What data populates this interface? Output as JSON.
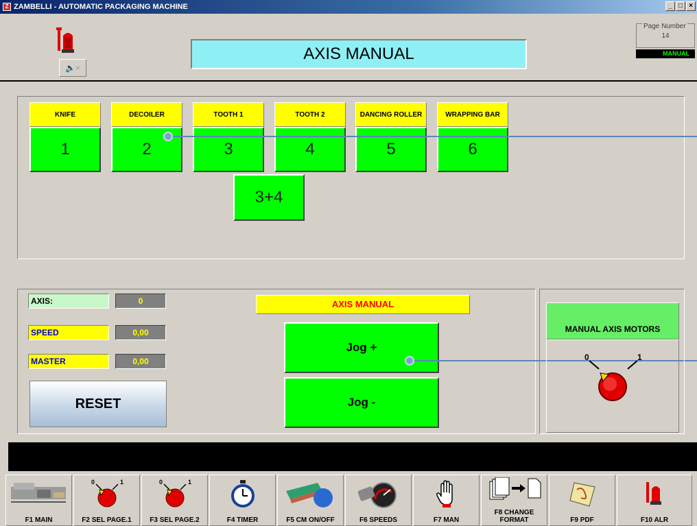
{
  "window": {
    "title": "ZAMBELLI - AUTOMATIC PACKAGING MACHINE",
    "controls": [
      "_",
      "□",
      "×"
    ]
  },
  "header": {
    "title": "AXIS MANUAL",
    "page_number_label": "Page Number",
    "page_number": "14",
    "mode": "MANUAL",
    "mute_icon": "speaker-mute-icon"
  },
  "axes": [
    {
      "label": "KNIFE",
      "number": "1"
    },
    {
      "label": "DECOILER",
      "number": "2"
    },
    {
      "label": "TOOTH 1",
      "number": "3"
    },
    {
      "label": "TOOTH 2",
      "number": "4"
    },
    {
      "label": "DANCING ROLLER",
      "number": "5"
    },
    {
      "label": "WRAPPING BAR",
      "number": "6"
    }
  ],
  "combo_axis": "3+4",
  "fields": {
    "axis": {
      "label": "AXIS:",
      "value": "0"
    },
    "speed": {
      "label": "SPEED",
      "value": "0,00"
    },
    "master": {
      "label": "MASTER",
      "value": "0,00"
    }
  },
  "reset_label": "RESET",
  "axis_manual_label": "AXIS MANUAL",
  "jog_plus": "Jog +",
  "jog_minus": "Jog -",
  "motors": {
    "title": "MANUAL AXIS MOTORS",
    "pos0": "0",
    "pos1": "1"
  },
  "fkeys": [
    {
      "label": "F1 MAIN",
      "icon": "machine-icon"
    },
    {
      "label": "F2 SEL PAGE.1",
      "icon": "selector-icon",
      "p0": "0",
      "p1": "1"
    },
    {
      "label": "F3 SEL PAGE.2",
      "icon": "selector-icon",
      "p0": "0",
      "p1": "1"
    },
    {
      "label": "F4 TIMER",
      "icon": "stopwatch-icon"
    },
    {
      "label": "F5 CM ON/OFF",
      "icon": "conveyor-icon"
    },
    {
      "label": "F6 SPEEDS",
      "icon": "speedometer-icon"
    },
    {
      "label": "F7 MAN",
      "icon": "hand-icon"
    },
    {
      "label": "F8 CHANGE FORMAT",
      "icon": "change-format-icon"
    },
    {
      "label": "F9 PDF",
      "icon": "pdf-icon"
    },
    {
      "label": "F10 ALR",
      "icon": "alarm-beacon-icon"
    }
  ],
  "colors": {
    "active_green": "#00ff00",
    "label_yellow": "#ffff00",
    "title_cyan": "#8ef0f5",
    "alarm_red": "#e00000"
  }
}
